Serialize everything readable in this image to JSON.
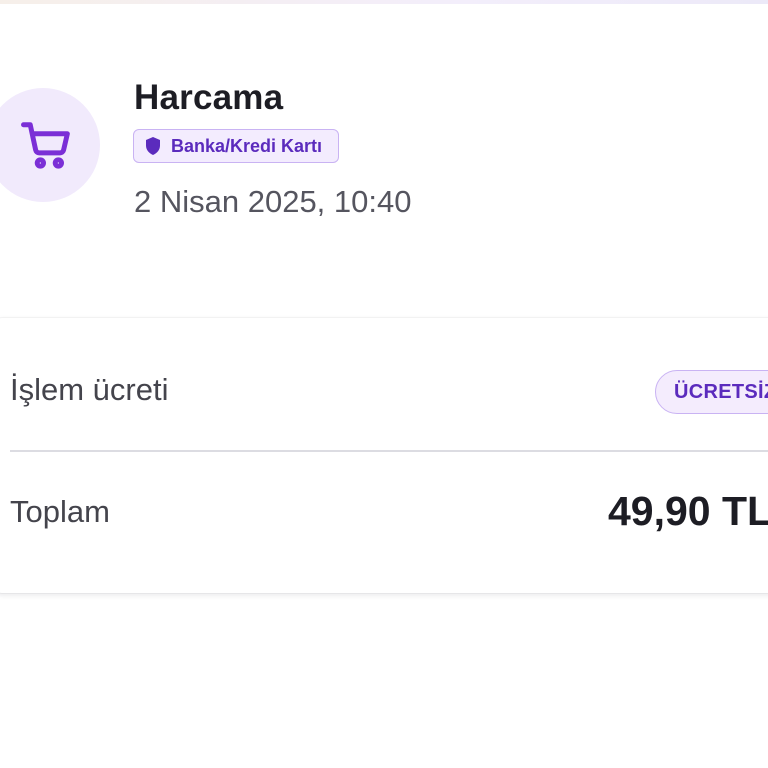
{
  "header": {
    "icon": "shopping-cart-icon",
    "title": "Harcama",
    "badge": {
      "icon": "shield-icon",
      "label": "Banka/Kredi Kartı"
    },
    "date": "2 Nisan 2025, 10:40"
  },
  "details": {
    "fee_label": "İşlem ücreti",
    "fee_badge": "ÜCRETSİZ",
    "total_label": "Toplam",
    "total_amount": "49,90 TL"
  },
  "colors": {
    "accent": "#5b2bbd",
    "accent_light": "#f1eafc",
    "text_primary": "#1d1d24",
    "text_secondary": "#55555f"
  }
}
